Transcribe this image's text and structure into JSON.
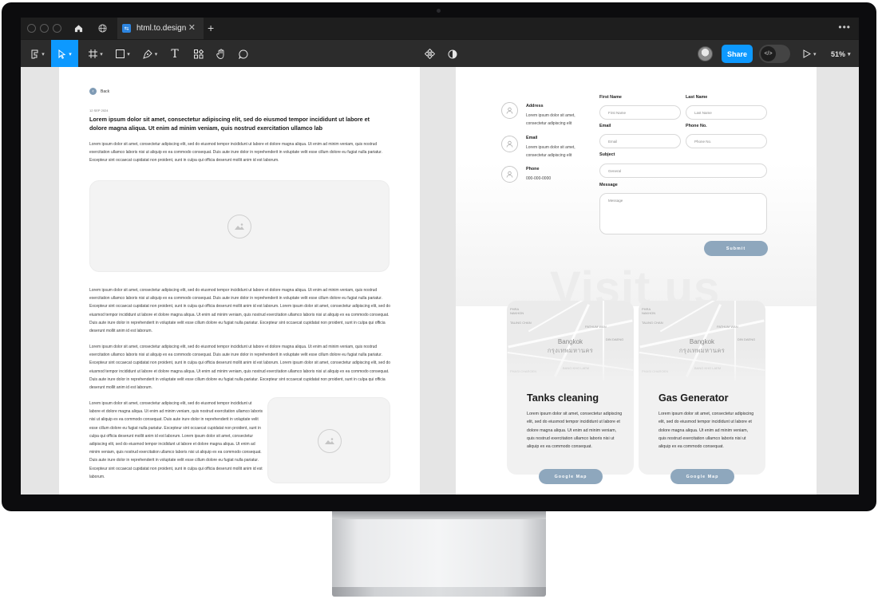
{
  "browser": {
    "tab_title": "html.to.design",
    "new_tab": "+",
    "menu": "•••"
  },
  "toolbar": {
    "share_label": "Share",
    "zoom_label": "51%",
    "tools": [
      "main-menu-icon",
      "move-icon",
      "frame-icon",
      "shape-icon",
      "pen-icon",
      "text-icon",
      "resources-icon",
      "hand-icon",
      "comment-icon",
      "components-icon",
      "contrast-icon",
      "code-icon",
      "play-icon"
    ]
  },
  "left_page": {
    "back_label": "Back",
    "date": "12 SEP 2024",
    "headline": "Lorem ipsum dolor sit amet, consectetur adipiscing elit, sed do eiusmod tempor incididunt ut labore et dolore magna aliqua. Ut enim ad minim veniam, quis nostrud exercitation ullamco lab",
    "paragraph_1": "Lorem ipsum dolor sit amet, consectetur adipiscing elit, sed do eiusmod tempor incididunt ut labore et dolore magna aliqua. Ut enim ad minim veniam, quis nostrud exercitation ullamco laboris nisi ut aliquip ex ea commodo consequat. Duis aute irure dolor in reprehenderit in voluptate velit esse cillum dolore eu fugiat nulla pariatur. Excepteur sint occaecat cupidatat non proident, sunt in culpa qui officia deserunt mollit anim id est laborum.",
    "paragraph_2": "Lorem ipsum dolor sit amet, consectetur adipiscing elit, sed do eiusmod tempor incididunt ut labore et dolore magna aliqua. Ut enim ad minim veniam, quis nostrud exercitation ullamco laboris nisi ut aliquip ex ea commodo consequat. Duis aute irure dolor in reprehenderit in voluptate velit esse cillum dolore eu fugiat nulla pariatur. Excepteur sint occaecat cupidatat non proident, sunt in culpa qui officia deserunt mollit anim id est laborum. Lorem ipsum dolor sit amet, consectetur adipiscing elit, sed do eiusmod tempor incididunt ut labore et dolore magna aliqua. Ut enim ad minim veniam, quis nostrud exercitation ullamco laboris nisi ut aliquip ex ea commodo consequat. Duis aute irure dolor in reprehenderit in voluptate velit esse cillum dolore eu fugiat nulla pariatur. Excepteur sint occaecat cupidatat non proident, sunt in culpa qui officia deserunt mollit anim id est laborum.",
    "paragraph_3": "Lorem ipsum dolor sit amet, consectetur adipiscing elit, sed do eiusmod tempor incididunt ut labore et dolore magna aliqua. Ut enim ad minim veniam, quis nostrud exercitation ullamco laboris nisi ut aliquip ex ea commodo consequat. Duis aute irure dolor in reprehenderit in voluptate velit esse cillum dolore eu fugiat nulla pariatur. Excepteur sint occaecat cupidatat non proident, sunt in culpa qui officia deserunt mollit anim id est laborum. Lorem ipsum dolor sit amet, consectetur adipiscing elit, sed do eiusmod tempor incididunt ut labore et dolore magna aliqua. Ut enim ad minim veniam, quis nostrud exercitation ullamco laboris nisi ut aliquip ex ea commodo consequat. Duis aute irure dolor in reprehenderit in voluptate velit esse cillum dolore eu fugiat nulla pariatur. Excepteur sint occaecat cupidatat non proident, sunt in culpa qui officia deserunt mollit anim id est laborum.",
    "paragraph_4": "Lorem ipsum dolor sit amet, consectetur adipiscing elit, sed do eiusmod tempor incididunt ut labore et dolore magna aliqua. Ut enim ad minim veniam, quis nostrud exercitation ullamco laboris nisi ut aliquip ex ea commodo consequat. Duis aute irure dolor in reprehenderit in voluptate velit esse cillum dolore eu fugiat nulla pariatur. Excepteur sint occaecat cupidatat non proident, sunt in culpa qui officia deserunt mollit anim id est laborum. Lorem ipsum dolor sit amet, consectetur adipiscing elit, sed do eiusmod tempor incididunt ut labore et dolore magna aliqua. Ut enim ad minim veniam, quis nostrud exercitation ullamco laboris nisi ut aliquip ex ea commodo consequat. Duis aute irure dolor in reprehenderit in voluptate velit esse cillum dolore eu fugiat nulla pariatur. Excepteur sint occaecat cupidatat non proident, sunt in culpa qui officia deserunt mollit anim id est laborum."
  },
  "contact": {
    "address_title": "Address",
    "address_text": "Lorem ipsum dolor sit amet, consectetur adipiscing elit",
    "email_title": "Email",
    "email_text": "Lorem ipsum dolor sit amet, consectetur adipiscing elit",
    "phone_title": "Phone",
    "phone_text": "000-000-0000",
    "first_name_label": "First Name",
    "first_name_placeholder": "First Name",
    "last_name_label": "Last Name",
    "last_name_placeholder": "Last Name",
    "email_label": "Email",
    "email_placeholder": "Email",
    "phone_label": "Phone No.",
    "phone_placeholder": "Phone No.",
    "subject_label": "Subject",
    "subject_value": "General",
    "message_label": "Message",
    "message_placeholder": "Message",
    "submit_label": "Submit"
  },
  "visit": {
    "heading": "Visit us",
    "cards": [
      {
        "title": "Tanks cleaning",
        "text": "Lorem ipsum dolor sit amet, consectetur adipiscing elit, sed do eiusmod tempor incididunt ut labore et dolore magna aliqua. Ut enim ad minim veniam, quis nostrud exercitation ullamco laboris nisi ut aliquip ex ea commodo consequat.",
        "button": "Google Map",
        "map_city": "Bangkok",
        "map_city_th": "กรุงเทพมหานคร"
      },
      {
        "title": "Gas Generator",
        "text": "Lorem ipsum dolor sit amet, consectetur adipiscing elit, sed do eiusmod tempor incididunt ut labore et dolore magna aliqua. Ut enim ad minim veniam, quis nostrud exercitation ullamco laboris nisi ut aliquip ex ea commodo consequat.",
        "button": "Google Map",
        "map_city": "Bangkok",
        "map_city_th": "กรุงเทพมหานคร"
      }
    ]
  }
}
